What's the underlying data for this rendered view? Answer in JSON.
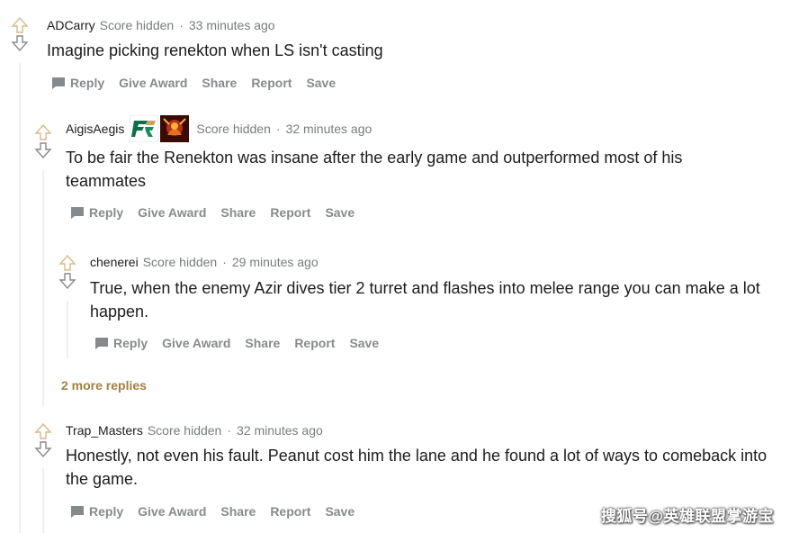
{
  "comments": [
    {
      "username": "ADCarry",
      "score": "Score hidden",
      "separator": "·",
      "time": "33 minutes ago",
      "body": "Imagine picking renekton when LS isn't casting",
      "actions": [
        "Reply",
        "Give Award",
        "Share",
        "Report",
        "Save"
      ]
    },
    {
      "username": "AigisAegis",
      "flair_icons": [
        "flyquest-logo-icon",
        "champion-portrait-icon"
      ],
      "score": "Score hidden",
      "separator": "·",
      "time": "32 minutes ago",
      "body": "To be fair the Renekton was insane after the early game and outperformed most of his teammates",
      "actions": [
        "Reply",
        "Give Award",
        "Share",
        "Report",
        "Save"
      ]
    },
    {
      "username": "chenerei",
      "score": "Score hidden",
      "separator": "·",
      "time": "29 minutes ago",
      "body": "True, when the enemy Azir dives tier 2 turret and flashes into melee range you can make a lot happen.",
      "actions": [
        "Reply",
        "Give Award",
        "Share",
        "Report",
        "Save"
      ]
    },
    {
      "username": "Trap_Masters",
      "score": "Score hidden",
      "separator": "·",
      "time": "32 minutes ago",
      "body": "Honestly, not even his fault. Peanut cost him the lane and he found a lot of ways to comeback into the game.",
      "actions": [
        "Reply",
        "Give Award",
        "Share",
        "Report",
        "Save"
      ]
    }
  ],
  "more_replies": "2 more replies",
  "watermark": "搜狐号@英雄联盟掌游宝",
  "colors": {
    "action_gray": "#878a8c",
    "meta_gray": "#787c7e",
    "more_link": "#a08142",
    "thread_line": "#edeff1"
  }
}
